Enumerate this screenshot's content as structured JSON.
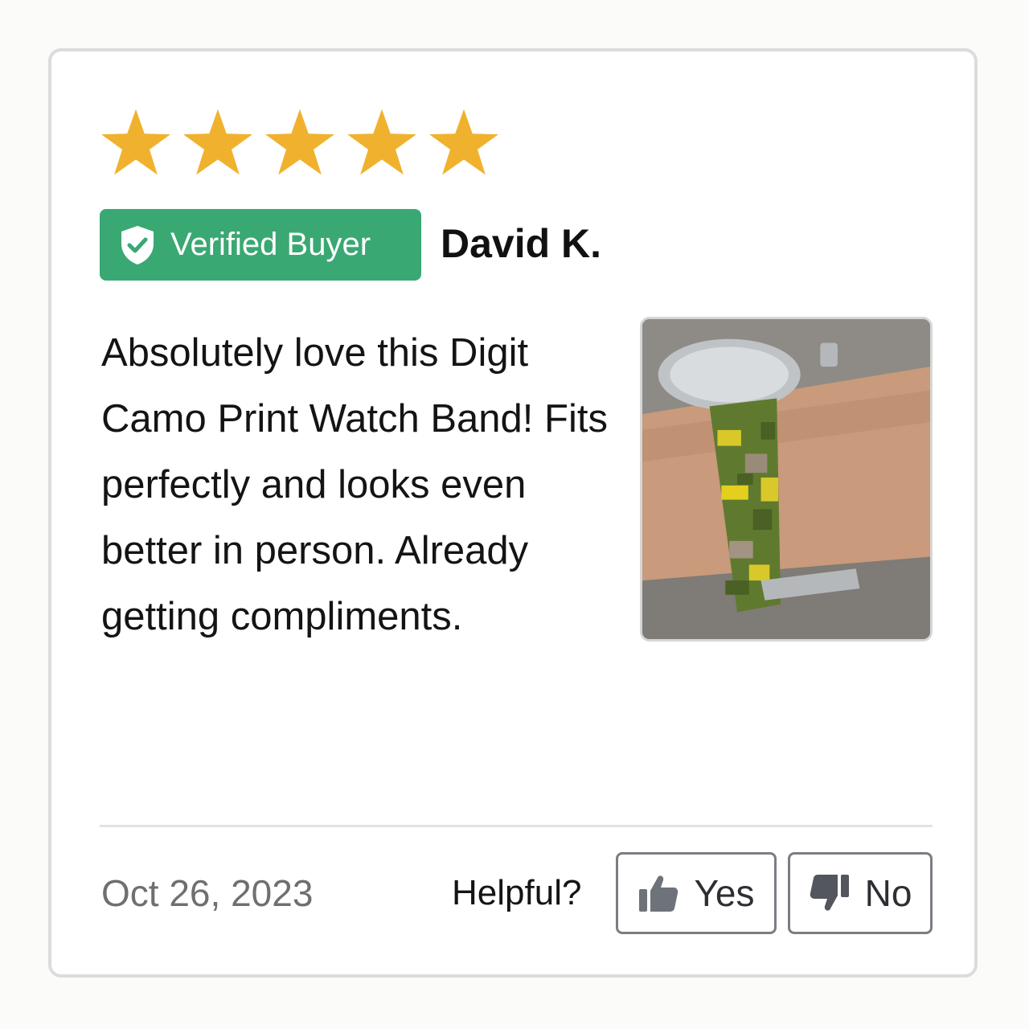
{
  "review": {
    "rating": 5,
    "rating_max": 5,
    "star_color": "#f0b22e",
    "badge": {
      "label": "Verified Buyer",
      "icon": "shield-check-icon",
      "color": "#3aa873"
    },
    "reviewer_name": "David K.",
    "text": "Absolutely love this Digit Camo Print Watch Band! Fits perfectly and looks even better in person. Already getting compliments.",
    "photo": "wrist-watch-camo-band-photo"
  },
  "footer": {
    "date": "Oct 26, 2023",
    "helpful_label": "Helpful?",
    "yes_label": "Yes",
    "yes_icon": "thumbs-up-icon",
    "no_label": "No",
    "no_icon": "thumbs-down-icon"
  }
}
